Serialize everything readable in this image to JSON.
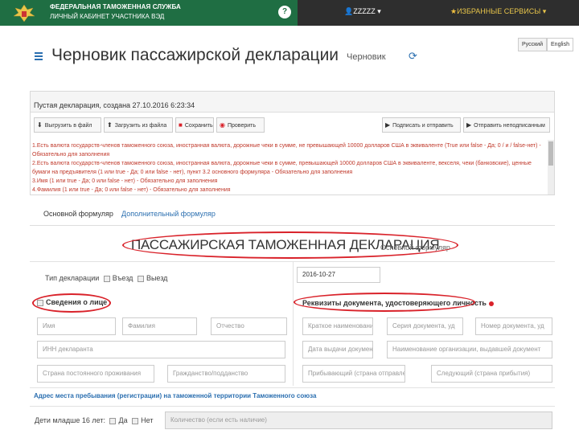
{
  "header": {
    "brand_line1": "ФЕДЕРАЛЬНАЯ ТАМОЖЕННАЯ СЛУЖБА",
    "brand_line2": "ЛИЧНЫЙ КАБИНЕТ УЧАСТНИКА ВЭД",
    "help": "?",
    "user": "ZZZZZ",
    "favorites": "ИЗБРАННЫЕ СЕРВИСЫ",
    "colors": {
      "green": "#1f6e43",
      "dark": "#2e2e2e",
      "accent": "#e8c54a"
    }
  },
  "lang": {
    "ru": "Русский",
    "en": "English"
  },
  "page": {
    "title": "Черновик пассажирской декларации",
    "status": "Черновик"
  },
  "panel": {
    "title": "Пустая декларация, создана 27.10.2016 6:23:34",
    "buttons": {
      "export": "Выгрузить в файл",
      "import": "Загрузить из файла",
      "save": "Сохранить",
      "check": "Проверить",
      "sign_send": "Подписать и отправить",
      "send_unsigned": "Отправить неподписанным"
    },
    "errors": [
      "1.Есть валюта государств-членов таможенного союза, иностранная валюта, дорожные чеки в сумме, не превышающей 10000 долларов США в эквиваленте (True или false - Да; 0 / и / false-нет) -",
      "Обязательно для заполнения",
      "2.Есть валюта государств-членов таможенного союза, иностранная валюта, дорожные чеки в сумме, превышающей 10000 долларов США в эквиваленте, векселя, чеки (банковские), ценные",
      "бумаги на предъявителя (1 или true - Да; 0 или false - нет), пункт 3.2 основного формуляра - Обязательно для заполнения",
      "3.Имя (1 или true - Да; 0 или false - нет) - Обязательно для заполнения",
      "4.Фамилия (1 или true - Да; 0 или false - нет) - Обязательно для заполнения"
    ]
  },
  "tabs": {
    "main": "Основной формуляр",
    "additional": "Дополнительный формуляр"
  },
  "form": {
    "title": "ПАССАЖИРСКАЯ ТАМОЖЕННАЯ ДЕКЛАРАЦИЯ",
    "subtitle": "Основной формуляр",
    "decl_type_label": "Тип декларации",
    "entry": "Въезд",
    "exit": "Выезд",
    "date_value": "2016-10-27",
    "person_section": "Сведения о лице",
    "doc_section": "Реквизиты документа, удостоверяющего личность",
    "placeholders": {
      "first_name": "Имя",
      "last_name": "Фамилия",
      "patronymic": "Отчество",
      "inn": "ИНН декларанта",
      "country_residence": "Страна постоянного проживания",
      "citizenship": "Гражданство/подданство",
      "doc_short": "Краткое наименование",
      "doc_series": "Серия документа, уд",
      "doc_number": "Номер документа, уд",
      "doc_date": "Дата выдачи документа",
      "doc_org": "Наименование организации, выдавшей документ",
      "arrival_country": "Прибывающий (страна отправления)",
      "next_country": "Следующий (страна прибытия)",
      "kids_count": "Количество (если есть наличие)"
    },
    "address_label": "Адрес места пребывания (регистрации) на таможенной территории Таможенного союза",
    "kids_label": "Дети младше 16 лет:",
    "yes": "Да",
    "no": "Нет"
  }
}
